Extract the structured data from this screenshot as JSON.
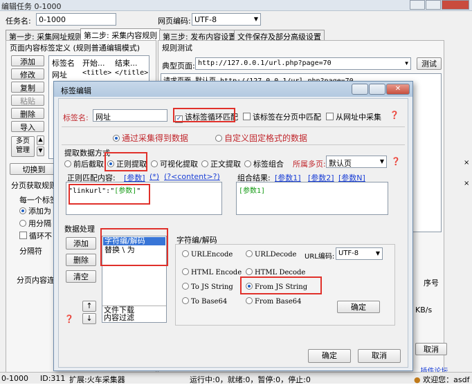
{
  "main": {
    "title": "编辑任务 0-1000",
    "task_name_label": "任务名:",
    "task_name_value": "0-1000",
    "encoding_label": "网页编码:",
    "encoding_value": "UTF-8",
    "tabs": [
      {
        "label": "第一步: 采集网址规则"
      },
      {
        "label": "第二步: 采集内容规则"
      },
      {
        "label": "第三步: 发布内容设置"
      },
      {
        "label": "文件保存及部分高级设置"
      }
    ],
    "left_group_title": "页面内容标签定义  (规则普通编辑模式)",
    "left_buttons": [
      "添加",
      "修改",
      "复制",
      "粘贴",
      "删除",
      "导入"
    ],
    "multipage_button": "多页\n管理",
    "tag_columns": [
      "标签名",
      "开始...",
      "结束..."
    ],
    "tag_rows": [
      {
        "name": "网址",
        "start": "<title>",
        "end": "</title>"
      }
    ],
    "switch_button": "切换到",
    "paging_label": "分页获取规则",
    "paging_each_label": "每一个标签",
    "paging_add_option": "添加为",
    "paging_sep_option": "用分隔",
    "paging_loop_option": "循环不",
    "separator_label": "分隔符",
    "paging_merge_label": "分页内容连",
    "rule_test_title": "规则测试",
    "typical_page_label": "典型页面:",
    "typical_page_value": "http://127.0.0.1/url.php?page=70",
    "test_button": "测试",
    "request_text": "请求页面 默认页 http://127.0.0.1/url.php?page=70",
    "seq_label": "序号",
    "speed_label": "KB/s",
    "cancel_button": "取消",
    "plugin_link": "...插件论坛",
    "status_left": "0-1000",
    "status_id": "ID:311",
    "status_plugin": "扩展:火车采集器",
    "status_running": "运行中:0，就绪:0，暂停:0，停止:0",
    "status_user": "欢迎您：asdf"
  },
  "dialog": {
    "title": "标签编辑",
    "tag_name_label": "标签名:",
    "tag_name_value": "网址",
    "loop_match_label": "该标签循环匹配",
    "paging_match_label": "该标签在分页中匹配",
    "from_url_label": "从网址中采集",
    "mode_collect": "通过采集得到数据",
    "mode_custom": "自定义固定格式的数据",
    "extract_group_label": "提取数据方式",
    "extract_options": [
      "前后截取",
      "正则提取",
      "可视化提取",
      "正文提取",
      "标签组合"
    ],
    "page_label": "所属多页:",
    "page_value": "默认页",
    "regex_label": "正则匹配内容:",
    "regex_links": [
      "[参数]",
      "(*)",
      "(?<content>?)"
    ],
    "regex_content_pre": "\"linkurl\":\"",
    "regex_content_param": "[参数]",
    "regex_content_post": "\"",
    "result_label": "组合结果:",
    "result_links": [
      "[参数1]",
      "[参数2]",
      "[参数N]"
    ],
    "result_content": "[参数1]",
    "process_label": "数据处理",
    "process_buttons": [
      "添加",
      "删除",
      "清空"
    ],
    "process_items": [
      "字符编/解码",
      "替换 \\ 为"
    ],
    "process_lower_items": [
      "文件下载",
      "内容过滤"
    ],
    "up_arrow": "↑",
    "down_arrow": "↓",
    "charset_group_label": "字符编/解码",
    "url_encode": "URLEncode",
    "url_decode": "URLDecode",
    "url_charset_label": "URL编码:",
    "url_charset_value": "UTF-8",
    "html_encode": "HTML Encode",
    "html_decode": "HTML Decode",
    "to_js_string": "To JS String",
    "from_js_string": "From JS String",
    "to_base64": "To Base64",
    "from_base64": "From Base64",
    "inner_ok_button": "确定",
    "ok_button": "确定",
    "cancel_button": "取消"
  }
}
